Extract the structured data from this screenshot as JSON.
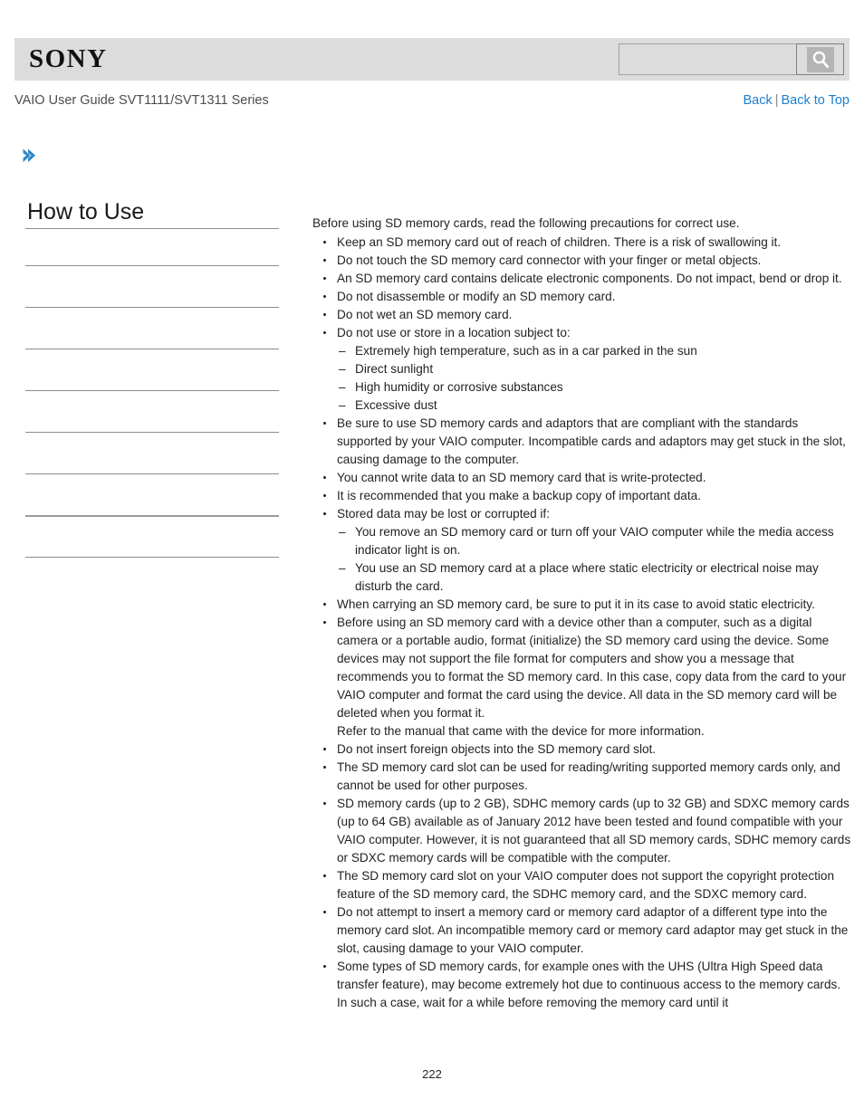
{
  "header": {
    "logo": "SONY",
    "search": {
      "value": "",
      "placeholder": "",
      "icon": "search-icon"
    }
  },
  "subheader": {
    "guide_title": "VAIO User Guide SVT1111/SVT1311 Series",
    "back_label": "Back",
    "separator": "|",
    "back_to_top_label": "Back to Top",
    "link_color": "#1a7ed1"
  },
  "breadcrumb_icon": "chevron-right-icon",
  "sidebar": {
    "title": "How to Use",
    "rows": [
      {
        "label": "",
        "divider": "thin"
      },
      {
        "label": "",
        "divider": "thin"
      },
      {
        "label": "",
        "divider": "thin"
      },
      {
        "label": "",
        "divider": "thin"
      },
      {
        "label": "",
        "divider": "thin"
      },
      {
        "label": "",
        "divider": "thin"
      },
      {
        "label": "",
        "divider": "thin"
      },
      {
        "label": "",
        "divider": "thick"
      },
      {
        "label": "",
        "divider": "thin"
      }
    ]
  },
  "content": {
    "intro": "Before using SD memory cards, read the following precautions for correct use.",
    "bullets": [
      {
        "text": "Keep an SD memory card out of reach of children. There is a risk of swallowing it."
      },
      {
        "text": "Do not touch the SD memory card connector with your finger or metal objects."
      },
      {
        "text": "An SD memory card contains delicate electronic components. Do not impact, bend or drop it."
      },
      {
        "text": "Do not disassemble or modify an SD memory card."
      },
      {
        "text": "Do not wet an SD memory card."
      },
      {
        "text": "Do not use or store in a location subject to:",
        "sub": [
          "Extremely high temperature, such as in a car parked in the sun",
          "Direct sunlight",
          "High humidity or corrosive substances",
          "Excessive dust"
        ]
      },
      {
        "text": "Be sure to use SD memory cards and adaptors that are compliant with the standards supported by your VAIO computer. Incompatible cards and adaptors may get stuck in the slot, causing damage to the computer."
      },
      {
        "text": "You cannot write data to an SD memory card that is write-protected."
      },
      {
        "text": "It is recommended that you make a backup copy of important data."
      },
      {
        "text": "Stored data may be lost or corrupted if:",
        "sub": [
          "You remove an SD memory card or turn off your VAIO computer while the media access indicator light is on.",
          "You use an SD memory card at a place where static electricity or electrical noise may disturb the card."
        ]
      },
      {
        "text": "When carrying an SD memory card, be sure to put it in its case to avoid static electricity."
      },
      {
        "text": "Before using an SD memory card with a device other than a computer, such as a digital camera or a portable audio, format (initialize) the SD memory card using the device. Some devices may not support the file format for computers and show you a message that recommends you to format the SD memory card. In this case, copy data from the card to your VAIO computer and format the card using the device. All data in the SD memory card will be deleted when you format it.",
        "extra": "Refer to the manual that came with the device for more information."
      },
      {
        "text": "Do not insert foreign objects into the SD memory card slot."
      },
      {
        "text": "The SD memory card slot can be used for reading/writing supported memory cards only, and cannot be used for other purposes."
      },
      {
        "text": "SD memory cards (up to 2 GB), SDHC memory cards (up to 32 GB) and SDXC memory cards (up to 64 GB) available as of January 2012 have been tested and found compatible with your VAIO computer. However, it is not guaranteed that all SD memory cards, SDHC memory cards or SDXC memory cards will be compatible with the computer."
      },
      {
        "text": "The SD memory card slot on your VAIO computer does not support the copyright protection feature of the SD memory card, the SDHC memory card, and the SDXC memory card."
      },
      {
        "text": "Do not attempt to insert a memory card or memory card adaptor of a different type into the memory card slot. An incompatible memory card or memory card adaptor may get stuck in the slot, causing damage to your VAIO computer."
      },
      {
        "text": "Some types of SD memory cards, for example ones with the UHS (Ultra High Speed data transfer feature), may become extremely hot due to continuous access to the memory cards. In such a case, wait for a while before removing the memory card until it"
      }
    ]
  },
  "footer": {
    "page_number": "222"
  }
}
